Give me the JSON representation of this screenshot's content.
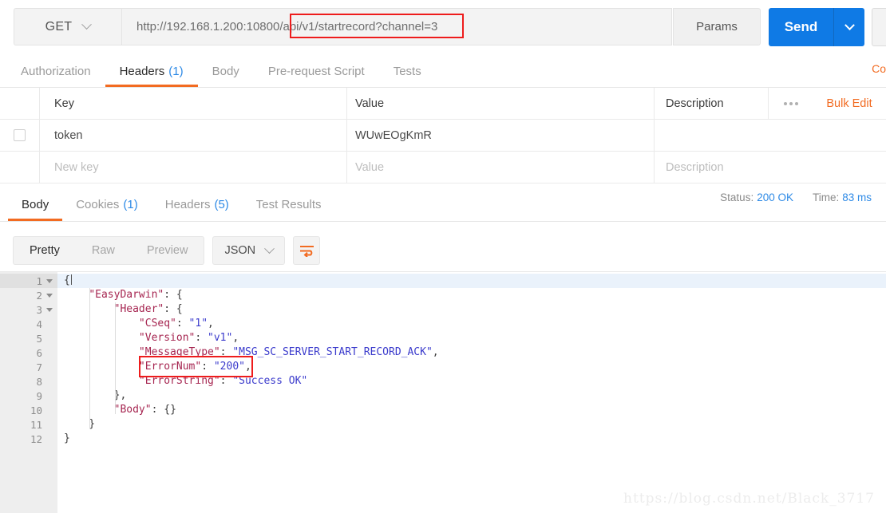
{
  "request": {
    "method": "GET",
    "url": "http://192.168.1.200:10800/api/v1/startrecord?channel=3",
    "url_prefix": "http://192.168.1.200:10800",
    "url_highlight": "/api/v1/startrecord?channel=3",
    "params_label": "Params",
    "send_label": "Send",
    "tabs": [
      {
        "label": "Authorization",
        "count": "",
        "active": false
      },
      {
        "label": "Headers",
        "count": "(1)",
        "active": true
      },
      {
        "label": "Body",
        "count": "",
        "active": false
      },
      {
        "label": "Pre-request Script",
        "count": "",
        "active": false
      },
      {
        "label": "Tests",
        "count": "",
        "active": false
      }
    ],
    "code_link": "Co"
  },
  "headers_table": {
    "columns": {
      "key": "Key",
      "value": "Value",
      "description": "Description"
    },
    "bulk_edit_label": "Bulk Edit",
    "rows": [
      {
        "key": "token",
        "value": "WUwEOgKmR",
        "description": ""
      }
    ],
    "new_row": {
      "key": "New key",
      "value": "Value",
      "description": "Description"
    }
  },
  "response": {
    "tabs": [
      {
        "label": "Body",
        "count": "",
        "active": true
      },
      {
        "label": "Cookies",
        "count": "(1)",
        "active": false
      },
      {
        "label": "Headers",
        "count": "(5)",
        "active": false
      },
      {
        "label": "Test Results",
        "count": "",
        "active": false
      }
    ],
    "status_label": "Status:",
    "status_value": "200 OK",
    "time_label": "Time:",
    "time_value": "83 ms",
    "view_modes": [
      {
        "label": "Pretty",
        "active": true
      },
      {
        "label": "Raw",
        "active": false
      },
      {
        "label": "Preview",
        "active": false
      }
    ],
    "format": "JSON",
    "body_lines": [
      {
        "n": "1",
        "fold": true,
        "tokens": [
          {
            "t": "p",
            "v": "{"
          }
        ],
        "caret": true
      },
      {
        "n": "2",
        "fold": true,
        "tokens": [
          {
            "t": "p",
            "v": "    "
          },
          {
            "t": "k",
            "v": "\"EasyDarwin\""
          },
          {
            "t": "p",
            "v": ": {"
          }
        ]
      },
      {
        "n": "3",
        "fold": true,
        "tokens": [
          {
            "t": "p",
            "v": "        "
          },
          {
            "t": "k",
            "v": "\"Header\""
          },
          {
            "t": "p",
            "v": ": {"
          }
        ]
      },
      {
        "n": "4",
        "fold": false,
        "tokens": [
          {
            "t": "p",
            "v": "            "
          },
          {
            "t": "k",
            "v": "\"CSeq\""
          },
          {
            "t": "p",
            "v": ": "
          },
          {
            "t": "s",
            "v": "\"1\""
          },
          {
            "t": "p",
            "v": ","
          }
        ]
      },
      {
        "n": "5",
        "fold": false,
        "tokens": [
          {
            "t": "p",
            "v": "            "
          },
          {
            "t": "k",
            "v": "\"Version\""
          },
          {
            "t": "p",
            "v": ": "
          },
          {
            "t": "s",
            "v": "\"v1\""
          },
          {
            "t": "p",
            "v": ","
          }
        ]
      },
      {
        "n": "6",
        "fold": false,
        "tokens": [
          {
            "t": "p",
            "v": "            "
          },
          {
            "t": "k",
            "v": "\"MessageType\""
          },
          {
            "t": "p",
            "v": ": "
          },
          {
            "t": "s",
            "v": "\"MSG_SC_SERVER_START_RECORD_ACK\""
          },
          {
            "t": "p",
            "v": ","
          }
        ]
      },
      {
        "n": "7",
        "fold": false,
        "tokens": [
          {
            "t": "p",
            "v": "            "
          },
          {
            "t": "k",
            "v": "\"ErrorNum\""
          },
          {
            "t": "p",
            "v": ": "
          },
          {
            "t": "s",
            "v": "\"200\""
          },
          {
            "t": "p",
            "v": ","
          }
        ]
      },
      {
        "n": "8",
        "fold": false,
        "tokens": [
          {
            "t": "p",
            "v": "            "
          },
          {
            "t": "k",
            "v": "\"ErrorString\""
          },
          {
            "t": "p",
            "v": ": "
          },
          {
            "t": "s",
            "v": "\"Success OK\""
          }
        ]
      },
      {
        "n": "9",
        "fold": false,
        "tokens": [
          {
            "t": "p",
            "v": "        },"
          }
        ]
      },
      {
        "n": "10",
        "fold": false,
        "tokens": [
          {
            "t": "p",
            "v": "        "
          },
          {
            "t": "k",
            "v": "\"Body\""
          },
          {
            "t": "p",
            "v": ": {}"
          }
        ]
      },
      {
        "n": "11",
        "fold": false,
        "tokens": [
          {
            "t": "p",
            "v": "    }"
          }
        ]
      },
      {
        "n": "12",
        "fold": false,
        "tokens": [
          {
            "t": "p",
            "v": "}"
          }
        ]
      }
    ]
  },
  "watermark": "https://blog.csdn.net/Black_3717",
  "colors": {
    "accent_orange": "#f26b21",
    "send_blue": "#0f7ae5",
    "link_blue": "#2e8ae6",
    "annotation_red": "#ee1c1c",
    "json_key": "#a62651",
    "json_string": "#3b3bcc"
  }
}
